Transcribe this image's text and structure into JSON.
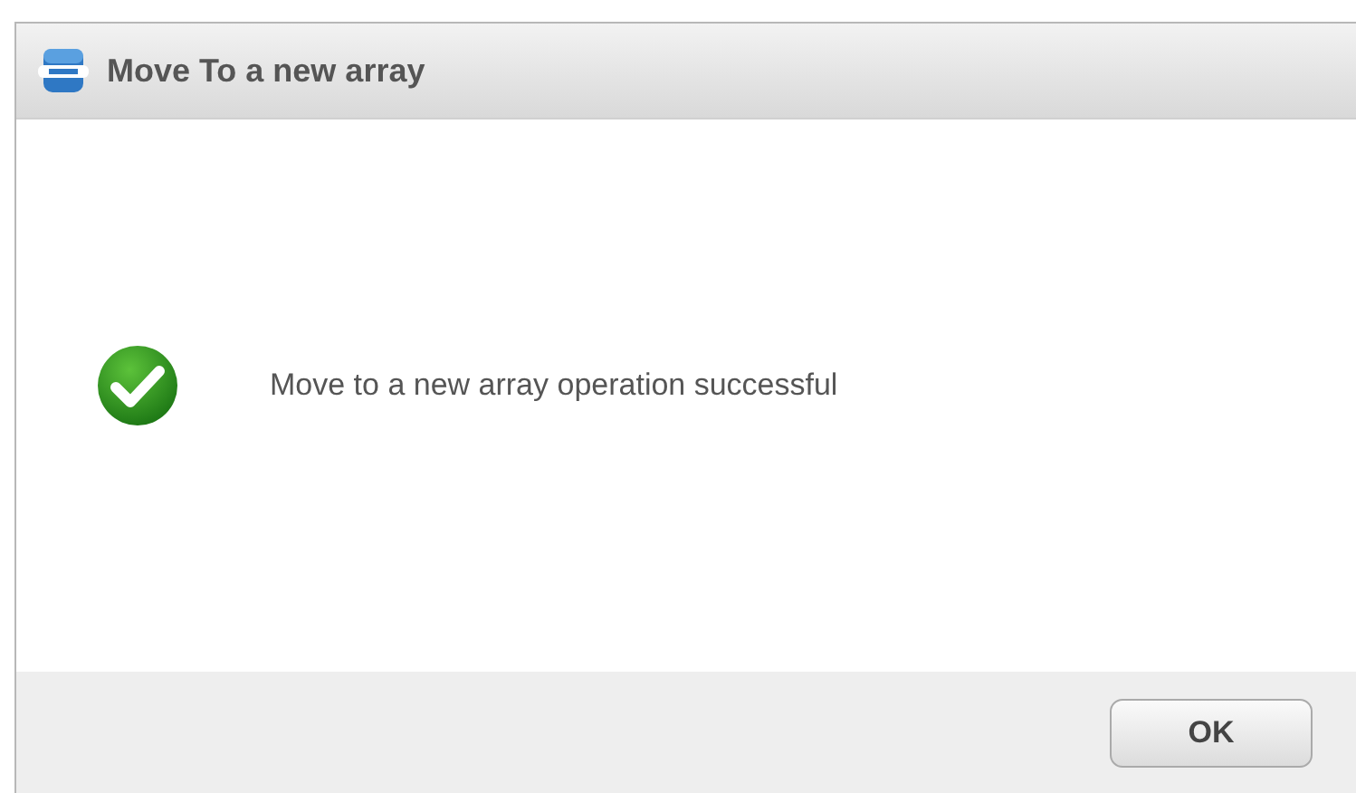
{
  "dialog": {
    "title": "Move To a new array",
    "message": "Move to a new array operation successful",
    "buttons": [
      "OK"
    ]
  }
}
